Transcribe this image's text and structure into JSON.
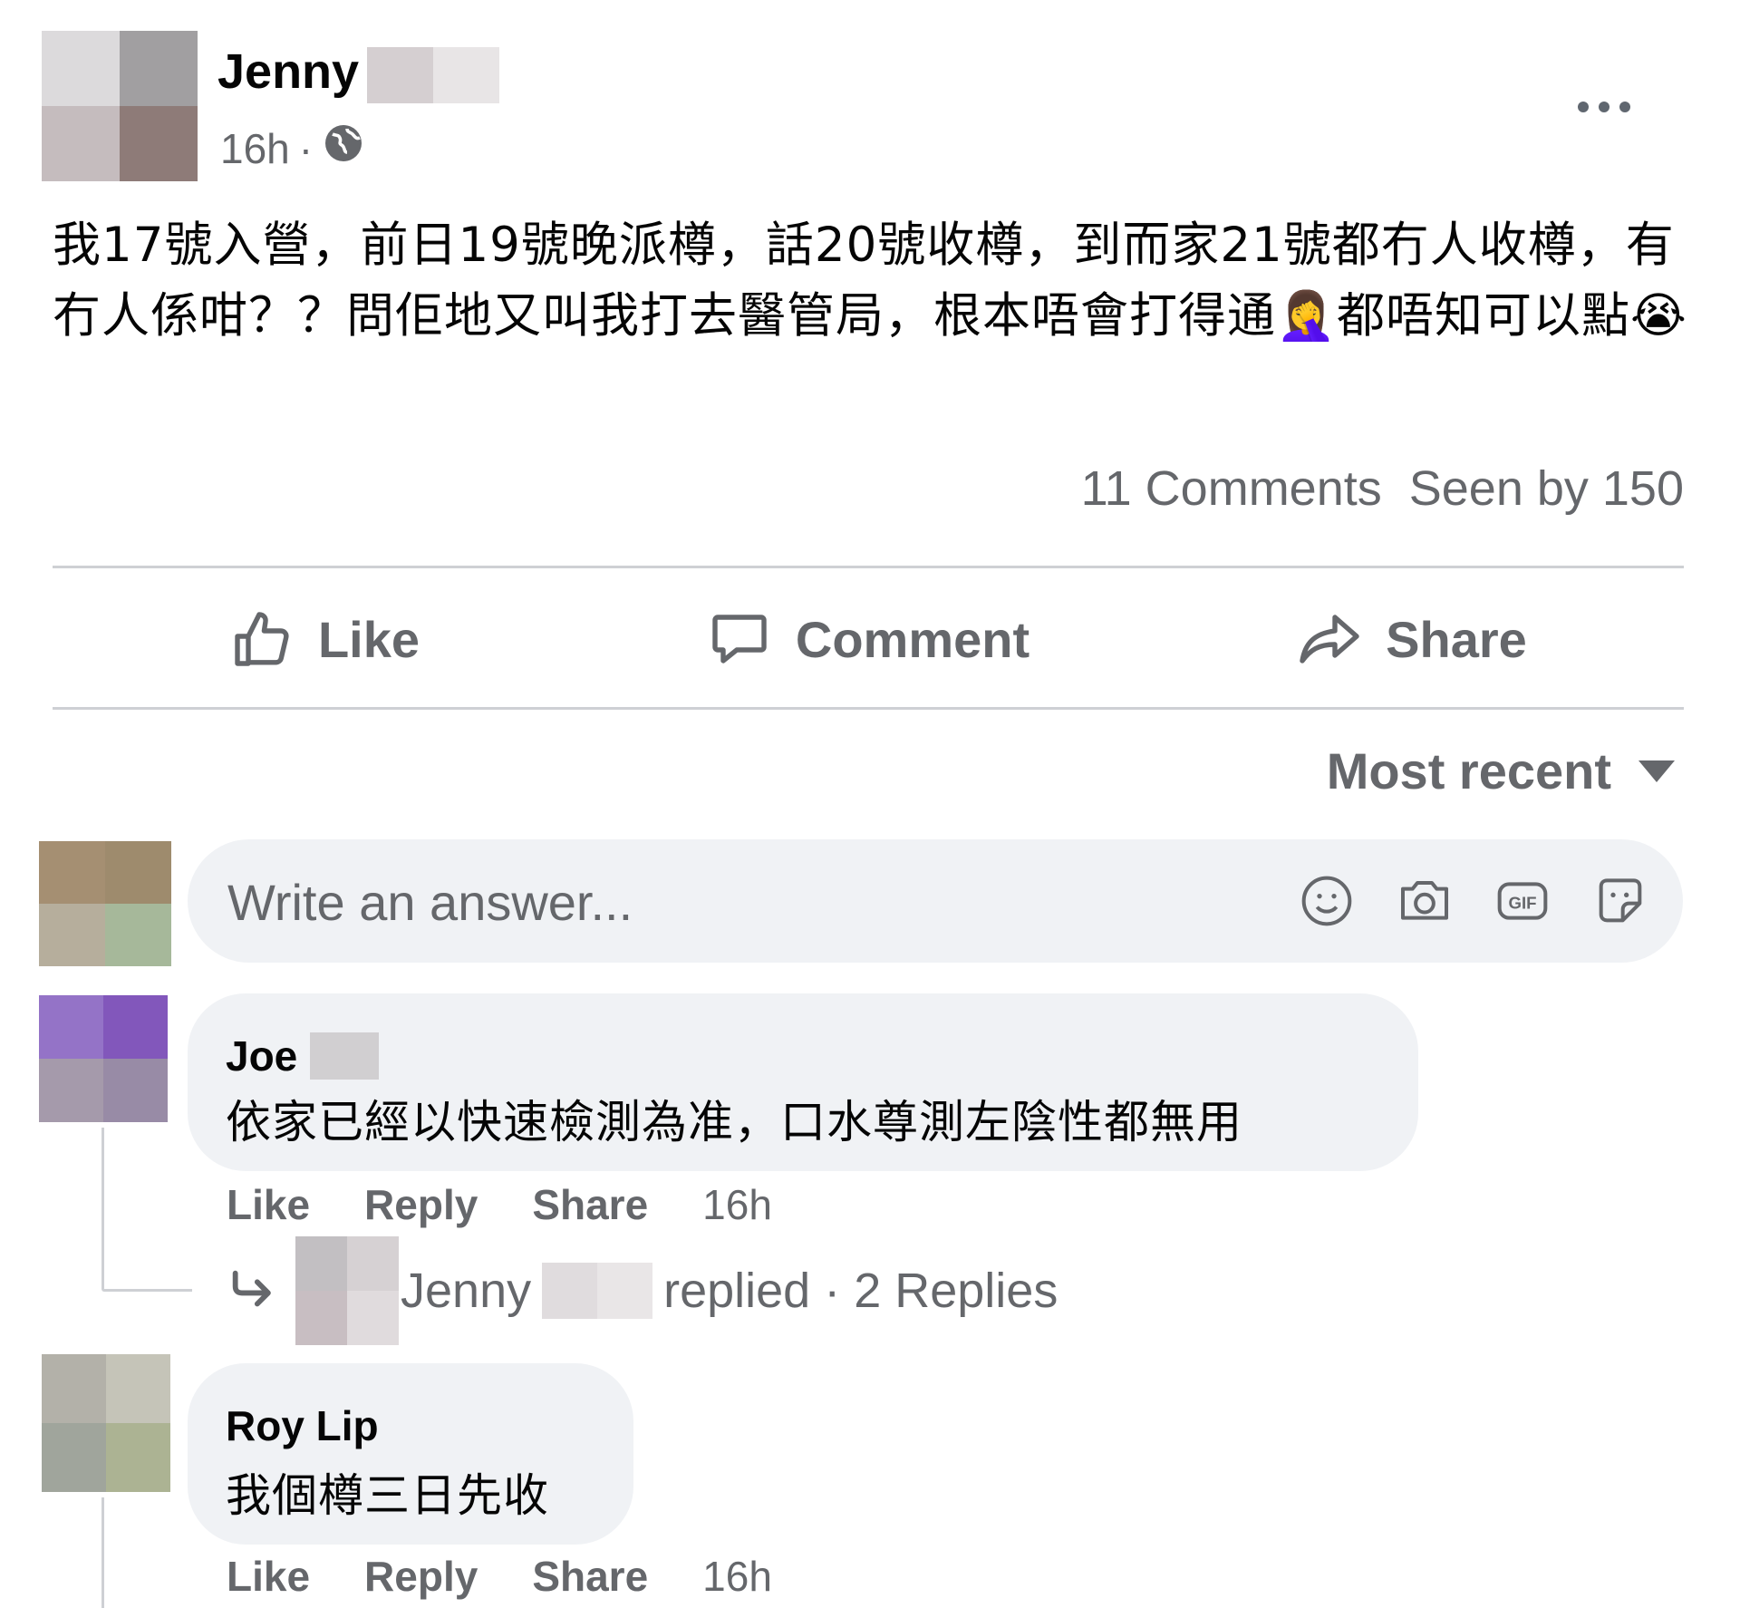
{
  "post": {
    "author_name": "Jenny",
    "time": "16h",
    "separator": "·",
    "body": "我17號入營，前日19號晚派樽，話20號收樽，到而家21號都冇人收樽，有冇人係咁？？問佢地又叫我打去醫管局，根本唔會打得通🤦‍♀️都唔知可以點😭",
    "comments_count": "11 Comments",
    "seen_by": "Seen by 150"
  },
  "actions": {
    "like": "Like",
    "comment": "Comment",
    "share": "Share"
  },
  "sort": {
    "label": "Most recent"
  },
  "composer": {
    "placeholder": "Write an answer..."
  },
  "comments": [
    {
      "name": "Joe",
      "text": "依家已經以快速檢測為准，口水尊測左陰性都無用",
      "like": "Like",
      "reply": "Reply",
      "share": "Share",
      "time": "16h",
      "replies_author": "Jenny",
      "replies_text": "replied · 2 Replies"
    },
    {
      "name": "Roy Lip",
      "text": "我個樽三日先收",
      "like": "Like",
      "reply": "Reply",
      "share": "Share",
      "time": "16h"
    }
  ],
  "colors": {
    "secondary_text": "#65676b",
    "bubble": "#f0f2f5",
    "divider": "#ced0d4"
  }
}
